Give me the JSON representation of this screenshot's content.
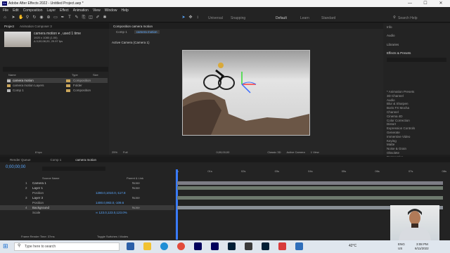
{
  "window": {
    "title": "Adobe After Effects 2022 - Untitled Project.aep *",
    "app_badge": "Ae",
    "minimize_glyph": "—",
    "maximize_glyph": "☐",
    "close_glyph": "✕"
  },
  "menu": [
    "File",
    "Edit",
    "Composition",
    "Layer",
    "Effect",
    "Animation",
    "View",
    "Window",
    "Help"
  ],
  "toolbar": {
    "universal": "Universal",
    "snapping": "Snapping",
    "workspaces": [
      "Default",
      "Learn",
      "Standard"
    ],
    "search_placeholder": "Search Help"
  },
  "project": {
    "tabs": [
      "Project",
      "Animation Composer 3"
    ],
    "preview_name": "camera motion ▾ , used 1 time",
    "preview_info1": "1920 x 1080 (1.00)",
    "preview_info2": "Δ 0;00;08;20, 29.97 fps",
    "col_name": "Name",
    "col_type": "Type",
    "col_size": "Size",
    "items": [
      {
        "name": "camera motion",
        "type": "Composition",
        "color": "#c9a55b"
      },
      {
        "name": "camera motion Layers",
        "type": "Folder",
        "color": "#c9a55b"
      },
      {
        "name": "Comp 1",
        "type": "Composition",
        "color": "#c9a55b"
      }
    ],
    "bpc": "8 bpc"
  },
  "composition": {
    "header": "Composition camera motion",
    "tabs": [
      "Comp 1",
      "camera motion"
    ],
    "view_label": "Active Camera (Camera 1)",
    "zoom": "25%",
    "resolution": "Full",
    "timecode": "0;00;00;00",
    "renderer": "Classic 3D",
    "camera": "Active Camera",
    "views": "1 View"
  },
  "right_panels": {
    "stack": [
      "Info",
      "Audio",
      "Libraries"
    ],
    "effects_title": "Effects & Presets",
    "effects": [
      "* Animation Presets",
      "3D Channel",
      "Audio",
      "Blur & Sharpen",
      "Boris FX Mocha",
      "Channel",
      "Cinema 4D",
      "Color Correction",
      "Distort",
      "Expression Controls",
      "Generate",
      "Immersive Video",
      "Keying",
      "Matte",
      "Noise & Grain",
      "Obsolete",
      "Perspective",
      "Simulation"
    ]
  },
  "timeline": {
    "tabs": [
      "Render Queue",
      "Comp 1",
      "camera motion"
    ],
    "timecode": "0;00;00;00",
    "col_source": "Source Name",
    "col_parent": "Parent & Link",
    "layers": [
      {
        "num": "1",
        "name": "Camera 1",
        "parent": "None",
        "prop": "",
        "value": ""
      },
      {
        "num": "2",
        "name": "Layer 1",
        "parent": "None",
        "prop": "Position",
        "value": "1280.0,1010.0,-117.8"
      },
      {
        "num": "3",
        "name": "Layer 3",
        "parent": "None",
        "prop": "Position",
        "value": "1400.0,983.0,-109.6"
      },
      {
        "num": "4",
        "name": "Background",
        "parent": "None",
        "prop": "Scale",
        "value": "∞ 123.0,123.0,123.0%"
      }
    ],
    "ruler": [
      "0s",
      "01s",
      "02s",
      "03s",
      "04s",
      "05s",
      "06s",
      "07s",
      "08s"
    ],
    "frame_render": "Frame Render Time:",
    "frame_render_value": "37ms",
    "toggle": "Toggle Switches / Modes"
  },
  "taskbar": {
    "search_placeholder": "Type here to search",
    "weather": "42°C",
    "lang1": "ENG",
    "lang2": "US",
    "time": "3:08 PM",
    "date": "6/11/2022"
  }
}
